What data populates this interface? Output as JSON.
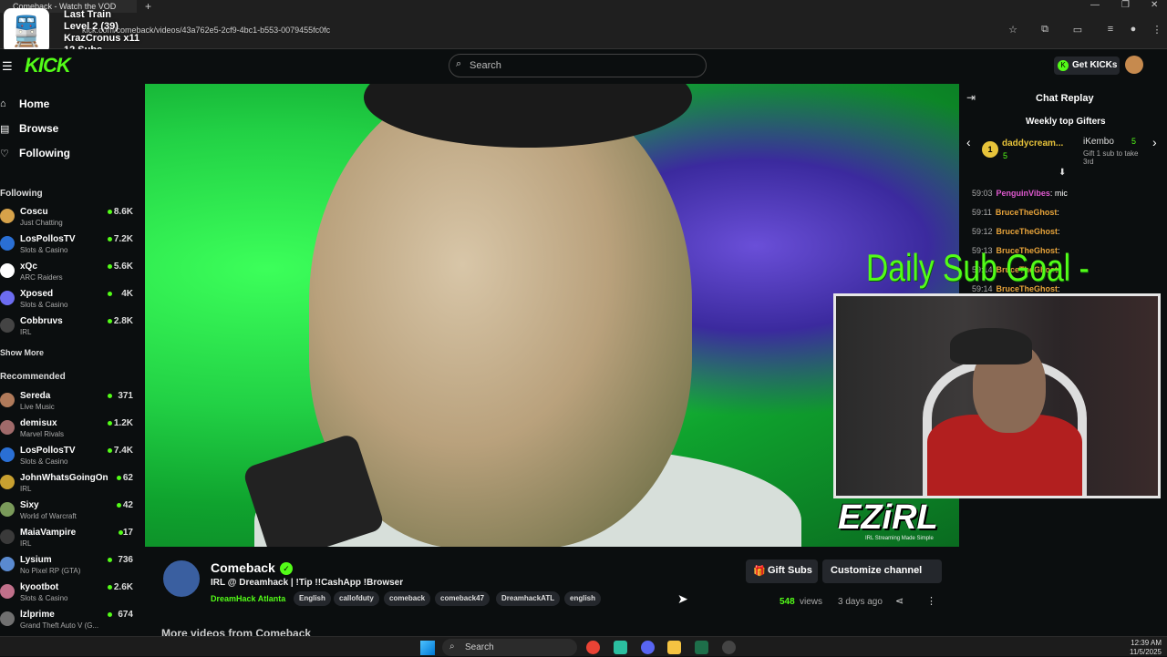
{
  "browser": {
    "tab_title": "Comeback - Watch the VOD",
    "new_tab": "+",
    "url": "kick.com/comeback/videos/43a762e5-2cf9-4bc1-b553-0079455fc0fc",
    "window_controls": [
      "—",
      "❐",
      "✕"
    ]
  },
  "overlay": {
    "lines": [
      "Last Train",
      "Level 2 (39)",
      "KrazCronus x11",
      "12 Subs"
    ]
  },
  "header": {
    "logo": "KICK",
    "search_placeholder": "Search",
    "get_kicks_label": "Get KICKs"
  },
  "sidebar": {
    "nav": [
      {
        "label": "Home",
        "icon": "home-icon"
      },
      {
        "label": "Browse",
        "icon": "compass-icon"
      },
      {
        "label": "Following",
        "icon": "heart-icon"
      }
    ],
    "following_heading": "Following",
    "following": [
      {
        "name": "Coscu",
        "category": "Just Chatting",
        "viewers": "8.6K",
        "color": "#d6a24a"
      },
      {
        "name": "LosPollosTV",
        "category": "Slots & Casino",
        "viewers": "7.2K",
        "color": "#2a6fd4"
      },
      {
        "name": "xQc",
        "category": "ARC Raiders",
        "viewers": "5.6K",
        "color": "#ffffff"
      },
      {
        "name": "Xposed",
        "category": "Slots & Casino",
        "viewers": "4K",
        "color": "#6c6cf0"
      },
      {
        "name": "Cobbruvs",
        "category": "IRL",
        "viewers": "2.8K",
        "color": "#444444"
      }
    ],
    "show_more": "Show More",
    "recommended_heading": "Recommended",
    "recommended": [
      {
        "name": "Sereda",
        "category": "Live Music",
        "viewers": "371",
        "color": "#b07a5a"
      },
      {
        "name": "demisux",
        "category": "Marvel Rivals",
        "viewers": "1.2K",
        "color": "#a06a6a"
      },
      {
        "name": "LosPollosTV",
        "category": "Slots & Casino",
        "viewers": "7.4K",
        "color": "#2a6fd4"
      },
      {
        "name": "JohnWhatsGoingOn",
        "category": "IRL",
        "viewers": "62",
        "color": "#c8a030"
      },
      {
        "name": "Sixy",
        "category": "World of Warcraft",
        "viewers": "42",
        "color": "#7a9a5a"
      },
      {
        "name": "MaiaVampire",
        "category": "IRL",
        "viewers": "17",
        "color": "#3a3a3a"
      },
      {
        "name": "Lysium",
        "category": "No Pixel RP (GTA)",
        "viewers": "736",
        "color": "#5a8ad0"
      },
      {
        "name": "kyootbot",
        "category": "Slots & Casino",
        "viewers": "2.6K",
        "color": "#c0708a"
      },
      {
        "name": "lzlprime",
        "category": "Grand Theft Auto V (G...",
        "viewers": "674",
        "color": "#707070"
      }
    ]
  },
  "video": {
    "watermark": "EZiRL",
    "watermark_sub": "IRL Streaming Made Simple"
  },
  "stream_overlay": {
    "goal_text": "Daily Sub Goal - 0/5"
  },
  "chat": {
    "title": "Chat Replay",
    "gifters_heading": "Weekly top Gifters",
    "gifter1": {
      "rank": "1",
      "name": "daddycream...",
      "count": "5"
    },
    "gifter2": {
      "name": "iKembo",
      "count": "5",
      "note": "Gift 1 sub to take 3rd"
    },
    "messages": [
      {
        "time": "59:03",
        "user": "PenguinVibes",
        "text": ": mic"
      },
      {
        "time": "59:11",
        "user": "BruceTheGhost",
        "text": ":"
      },
      {
        "time": "59:12",
        "user": "BruceTheGhost",
        "text": ":"
      },
      {
        "time": "59:13",
        "user": "BruceTheGhost",
        "text": ":"
      },
      {
        "time": "59:14",
        "user": "BruceTheGhost",
        "text": ":"
      },
      {
        "time": "59:14",
        "user": "BruceTheGhost",
        "text": ":"
      }
    ]
  },
  "channel": {
    "name": "Comeback",
    "title": "IRL @ Dreamhack | !Tip !!CashApp !Browser",
    "category": "DreamHack Atlanta",
    "tags": [
      "English",
      "callofduty",
      "comeback",
      "comeback47",
      "DreamhackATL",
      "english"
    ],
    "gift_subs_label": "Gift Subs",
    "customize_label": "Customize channel",
    "views_count": "548",
    "views_label": "views",
    "ago": "3 days ago",
    "more_videos": "More videos from Comeback"
  },
  "taskbar": {
    "search_placeholder": "Search",
    "time": "12:39 AM",
    "date": "11/5/2025"
  }
}
